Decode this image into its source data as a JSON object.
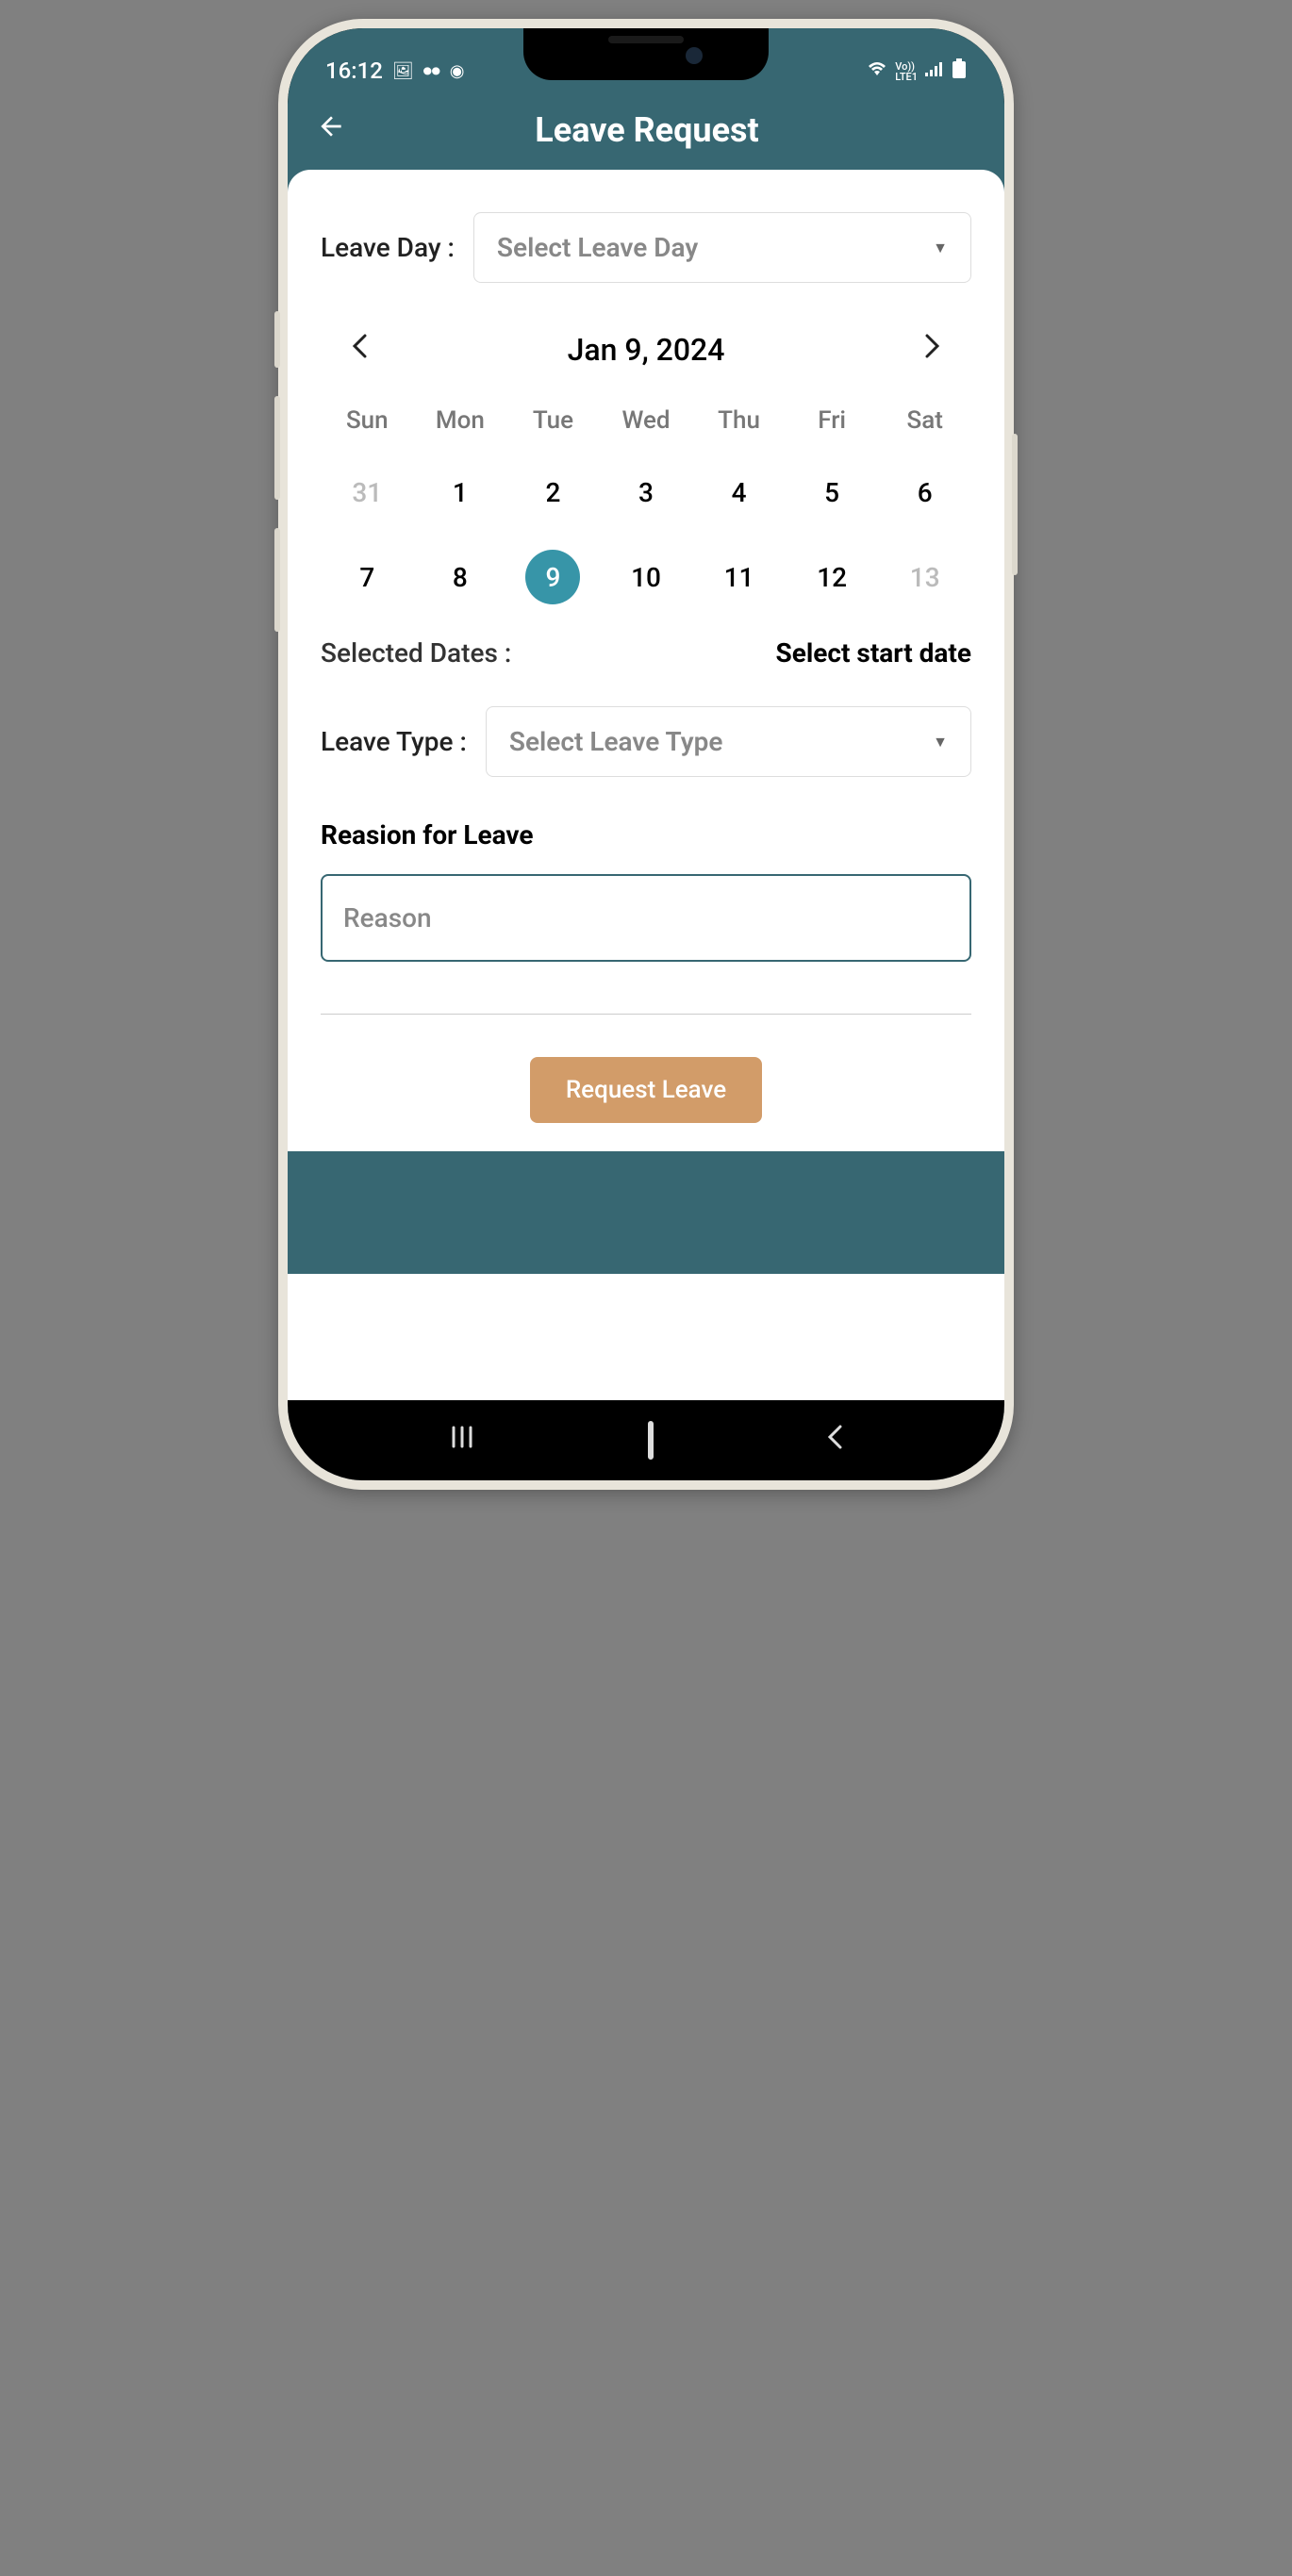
{
  "status": {
    "time": "16:12",
    "lte": "LTE1",
    "vo": "Vo))"
  },
  "header": {
    "title": "Leave Request"
  },
  "form": {
    "leave_day_label": "Leave Day :",
    "leave_day_placeholder": "Select Leave Day",
    "leave_type_label": "Leave Type :",
    "leave_type_placeholder": "Select Leave Type",
    "selected_dates_label": "Selected Dates :",
    "selected_dates_value": "Select start date",
    "reason_label": "Reasion for Leave",
    "reason_placeholder": "Reason",
    "submit_label": "Request Leave"
  },
  "calendar": {
    "title": "Jan 9, 2024",
    "dow": [
      "Sun",
      "Mon",
      "Tue",
      "Wed",
      "Thu",
      "Fri",
      "Sat"
    ],
    "days": [
      {
        "d": "31",
        "muted": true
      },
      {
        "d": "1"
      },
      {
        "d": "2"
      },
      {
        "d": "3"
      },
      {
        "d": "4"
      },
      {
        "d": "5"
      },
      {
        "d": "6"
      },
      {
        "d": "7"
      },
      {
        "d": "8"
      },
      {
        "d": "9",
        "selected": true
      },
      {
        "d": "10"
      },
      {
        "d": "11"
      },
      {
        "d": "12"
      },
      {
        "d": "13",
        "muted": true
      }
    ]
  }
}
